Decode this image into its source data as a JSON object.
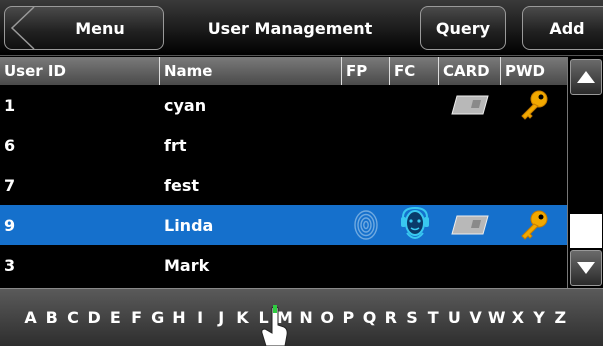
{
  "header": {
    "menu_label": "Menu",
    "title": "User Management",
    "query_label": "Query",
    "add_label": "Add"
  },
  "table": {
    "columns": [
      "User ID",
      "Name",
      "FP",
      "FC",
      "CARD",
      "PWD"
    ],
    "rows": [
      {
        "id": "1",
        "name": "cyan",
        "fp": false,
        "fc": false,
        "card": true,
        "pwd": true,
        "selected": false
      },
      {
        "id": "6",
        "name": "frt",
        "fp": false,
        "fc": false,
        "card": false,
        "pwd": false,
        "selected": false
      },
      {
        "id": "7",
        "name": "fest",
        "fp": false,
        "fc": false,
        "card": false,
        "pwd": false,
        "selected": false
      },
      {
        "id": "9",
        "name": "Linda",
        "fp": true,
        "fc": true,
        "card": true,
        "pwd": true,
        "selected": true
      },
      {
        "id": "3",
        "name": "Mark",
        "fp": false,
        "fc": false,
        "card": false,
        "pwd": false,
        "selected": false
      }
    ]
  },
  "icons": {
    "fingerprint": "fingerprint-icon",
    "face": "face-icon",
    "card": "card-icon",
    "password": "key-icon",
    "scroll_up": "triangle-up-icon",
    "scroll_down": "triangle-down-icon"
  },
  "colors": {
    "selected_row": "#1570cc",
    "key": "#f2a900"
  },
  "alphabet": [
    "A",
    "B",
    "C",
    "D",
    "E",
    "F",
    "G",
    "H",
    "I",
    "J",
    "K",
    "L",
    "M",
    "N",
    "O",
    "P",
    "Q",
    "R",
    "S",
    "T",
    "U",
    "V",
    "W",
    "X",
    "Y",
    "Z"
  ]
}
